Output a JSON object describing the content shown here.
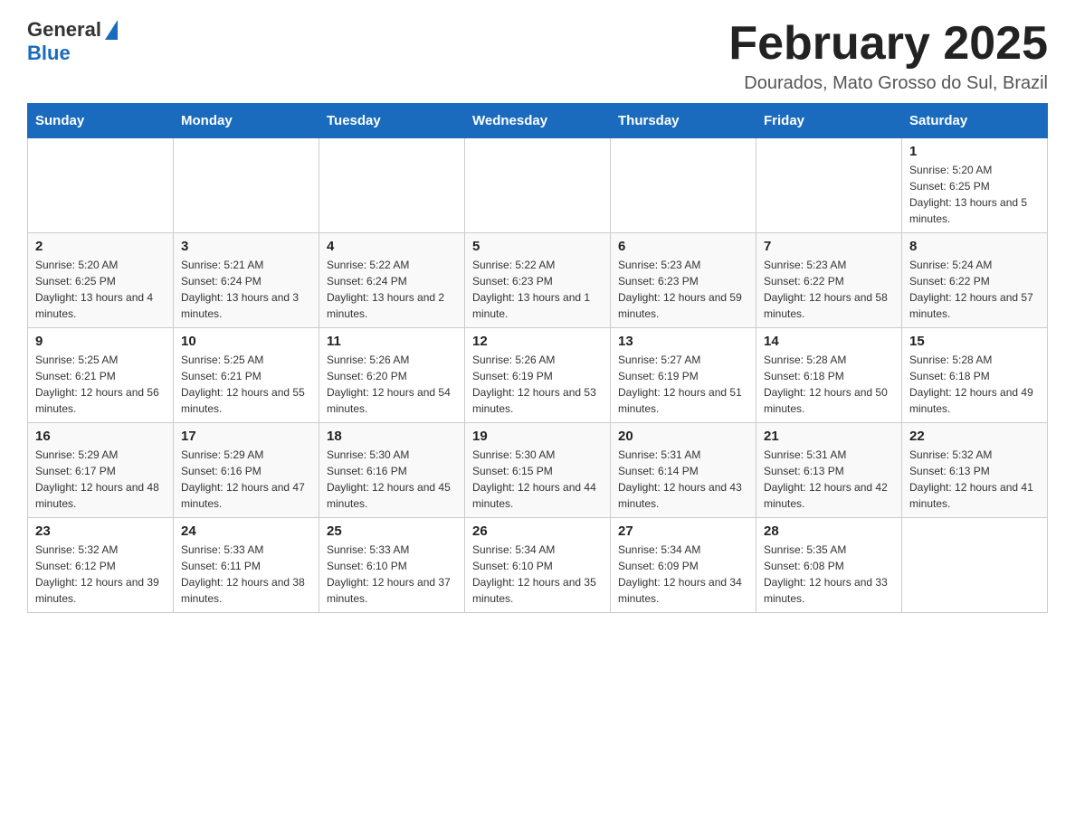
{
  "header": {
    "logo_general": "General",
    "logo_blue": "Blue",
    "title": "February 2025",
    "subtitle": "Dourados, Mato Grosso do Sul, Brazil"
  },
  "calendar": {
    "days_of_week": [
      "Sunday",
      "Monday",
      "Tuesday",
      "Wednesday",
      "Thursday",
      "Friday",
      "Saturday"
    ],
    "weeks": [
      [
        {
          "day": "",
          "sunrise": "",
          "sunset": "",
          "daylight": ""
        },
        {
          "day": "",
          "sunrise": "",
          "sunset": "",
          "daylight": ""
        },
        {
          "day": "",
          "sunrise": "",
          "sunset": "",
          "daylight": ""
        },
        {
          "day": "",
          "sunrise": "",
          "sunset": "",
          "daylight": ""
        },
        {
          "day": "",
          "sunrise": "",
          "sunset": "",
          "daylight": ""
        },
        {
          "day": "",
          "sunrise": "",
          "sunset": "",
          "daylight": ""
        },
        {
          "day": "1",
          "sunrise": "Sunrise: 5:20 AM",
          "sunset": "Sunset: 6:25 PM",
          "daylight": "Daylight: 13 hours and 5 minutes."
        }
      ],
      [
        {
          "day": "2",
          "sunrise": "Sunrise: 5:20 AM",
          "sunset": "Sunset: 6:25 PM",
          "daylight": "Daylight: 13 hours and 4 minutes."
        },
        {
          "day": "3",
          "sunrise": "Sunrise: 5:21 AM",
          "sunset": "Sunset: 6:24 PM",
          "daylight": "Daylight: 13 hours and 3 minutes."
        },
        {
          "day": "4",
          "sunrise": "Sunrise: 5:22 AM",
          "sunset": "Sunset: 6:24 PM",
          "daylight": "Daylight: 13 hours and 2 minutes."
        },
        {
          "day": "5",
          "sunrise": "Sunrise: 5:22 AM",
          "sunset": "Sunset: 6:23 PM",
          "daylight": "Daylight: 13 hours and 1 minute."
        },
        {
          "day": "6",
          "sunrise": "Sunrise: 5:23 AM",
          "sunset": "Sunset: 6:23 PM",
          "daylight": "Daylight: 12 hours and 59 minutes."
        },
        {
          "day": "7",
          "sunrise": "Sunrise: 5:23 AM",
          "sunset": "Sunset: 6:22 PM",
          "daylight": "Daylight: 12 hours and 58 minutes."
        },
        {
          "day": "8",
          "sunrise": "Sunrise: 5:24 AM",
          "sunset": "Sunset: 6:22 PM",
          "daylight": "Daylight: 12 hours and 57 minutes."
        }
      ],
      [
        {
          "day": "9",
          "sunrise": "Sunrise: 5:25 AM",
          "sunset": "Sunset: 6:21 PM",
          "daylight": "Daylight: 12 hours and 56 minutes."
        },
        {
          "day": "10",
          "sunrise": "Sunrise: 5:25 AM",
          "sunset": "Sunset: 6:21 PM",
          "daylight": "Daylight: 12 hours and 55 minutes."
        },
        {
          "day": "11",
          "sunrise": "Sunrise: 5:26 AM",
          "sunset": "Sunset: 6:20 PM",
          "daylight": "Daylight: 12 hours and 54 minutes."
        },
        {
          "day": "12",
          "sunrise": "Sunrise: 5:26 AM",
          "sunset": "Sunset: 6:19 PM",
          "daylight": "Daylight: 12 hours and 53 minutes."
        },
        {
          "day": "13",
          "sunrise": "Sunrise: 5:27 AM",
          "sunset": "Sunset: 6:19 PM",
          "daylight": "Daylight: 12 hours and 51 minutes."
        },
        {
          "day": "14",
          "sunrise": "Sunrise: 5:28 AM",
          "sunset": "Sunset: 6:18 PM",
          "daylight": "Daylight: 12 hours and 50 minutes."
        },
        {
          "day": "15",
          "sunrise": "Sunrise: 5:28 AM",
          "sunset": "Sunset: 6:18 PM",
          "daylight": "Daylight: 12 hours and 49 minutes."
        }
      ],
      [
        {
          "day": "16",
          "sunrise": "Sunrise: 5:29 AM",
          "sunset": "Sunset: 6:17 PM",
          "daylight": "Daylight: 12 hours and 48 minutes."
        },
        {
          "day": "17",
          "sunrise": "Sunrise: 5:29 AM",
          "sunset": "Sunset: 6:16 PM",
          "daylight": "Daylight: 12 hours and 47 minutes."
        },
        {
          "day": "18",
          "sunrise": "Sunrise: 5:30 AM",
          "sunset": "Sunset: 6:16 PM",
          "daylight": "Daylight: 12 hours and 45 minutes."
        },
        {
          "day": "19",
          "sunrise": "Sunrise: 5:30 AM",
          "sunset": "Sunset: 6:15 PM",
          "daylight": "Daylight: 12 hours and 44 minutes."
        },
        {
          "day": "20",
          "sunrise": "Sunrise: 5:31 AM",
          "sunset": "Sunset: 6:14 PM",
          "daylight": "Daylight: 12 hours and 43 minutes."
        },
        {
          "day": "21",
          "sunrise": "Sunrise: 5:31 AM",
          "sunset": "Sunset: 6:13 PM",
          "daylight": "Daylight: 12 hours and 42 minutes."
        },
        {
          "day": "22",
          "sunrise": "Sunrise: 5:32 AM",
          "sunset": "Sunset: 6:13 PM",
          "daylight": "Daylight: 12 hours and 41 minutes."
        }
      ],
      [
        {
          "day": "23",
          "sunrise": "Sunrise: 5:32 AM",
          "sunset": "Sunset: 6:12 PM",
          "daylight": "Daylight: 12 hours and 39 minutes."
        },
        {
          "day": "24",
          "sunrise": "Sunrise: 5:33 AM",
          "sunset": "Sunset: 6:11 PM",
          "daylight": "Daylight: 12 hours and 38 minutes."
        },
        {
          "day": "25",
          "sunrise": "Sunrise: 5:33 AM",
          "sunset": "Sunset: 6:10 PM",
          "daylight": "Daylight: 12 hours and 37 minutes."
        },
        {
          "day": "26",
          "sunrise": "Sunrise: 5:34 AM",
          "sunset": "Sunset: 6:10 PM",
          "daylight": "Daylight: 12 hours and 35 minutes."
        },
        {
          "day": "27",
          "sunrise": "Sunrise: 5:34 AM",
          "sunset": "Sunset: 6:09 PM",
          "daylight": "Daylight: 12 hours and 34 minutes."
        },
        {
          "day": "28",
          "sunrise": "Sunrise: 5:35 AM",
          "sunset": "Sunset: 6:08 PM",
          "daylight": "Daylight: 12 hours and 33 minutes."
        },
        {
          "day": "",
          "sunrise": "",
          "sunset": "",
          "daylight": ""
        }
      ]
    ]
  }
}
